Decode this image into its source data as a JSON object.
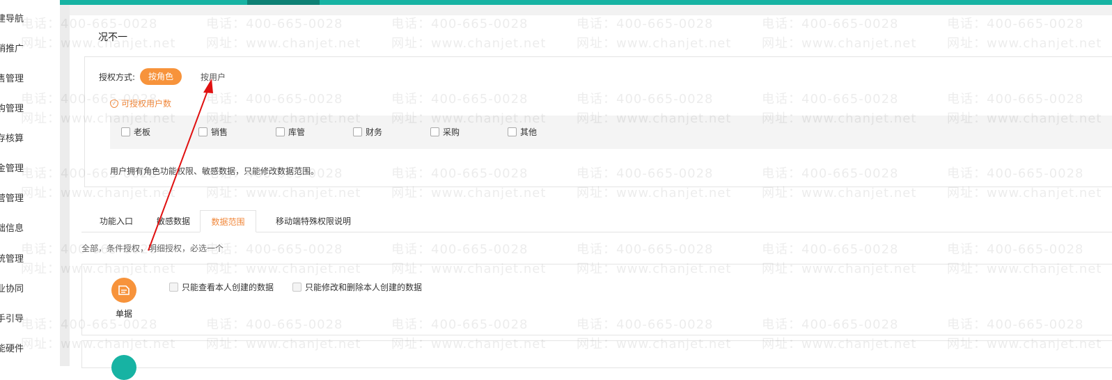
{
  "sidebar": {
    "items": [
      "建导航",
      "销推广",
      "售管理",
      "购管理",
      "存核算",
      "金管理",
      "营管理",
      "础信息",
      "统管理",
      "业协同",
      "手引导",
      "能硬件"
    ]
  },
  "header": {
    "title": "况不一"
  },
  "authorization": {
    "method_label": "授权方式:",
    "by_role_label": "按角色",
    "by_user_label": "按用户",
    "quota_label": "可授权用户数",
    "roles": [
      "老板",
      "销售",
      "库管",
      "财务",
      "采购",
      "其他"
    ],
    "description": "用户拥有角色功能权限、敏感数据，只能修改数据范围。"
  },
  "tabs": [
    {
      "label": "功能入口",
      "active": false
    },
    {
      "label": "敏感数据",
      "active": false
    },
    {
      "label": "数据范围",
      "active": true
    },
    {
      "label": "移动端特殊权限说明",
      "active": false
    }
  ],
  "data_scope": {
    "note": "全部，条件授权，明细授权，必选一个",
    "documents": {
      "label": "单据",
      "options": [
        "只能查看本人创建的数据",
        "只能修改和删除本人创建的数据"
      ]
    }
  },
  "watermark": {
    "phone": "电话：400-665-0028",
    "url": "网址：www.chanjet.net"
  },
  "colors": {
    "accent_orange": "#f7933b",
    "teal": "#17b3a3",
    "arrow_red": "#e01010"
  }
}
